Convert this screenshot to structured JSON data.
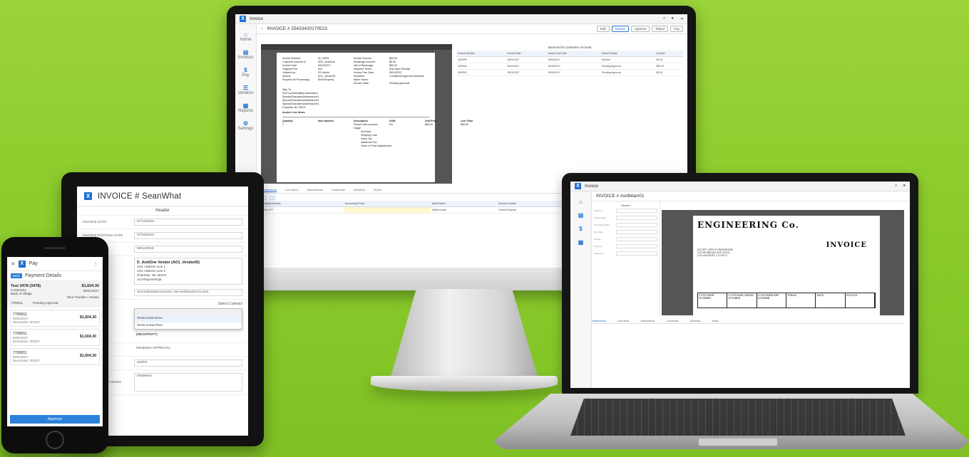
{
  "desktop": {
    "app_name": "Invoice",
    "title": "INVOICE # 25433420170523",
    "toolbar_buttons": [
      "Edit",
      "Submit",
      "Approve",
      "Reject",
      "Pay"
    ],
    "sidebar": [
      "Home",
      "Invoices",
      "Pay",
      "Vendors",
      "Reports",
      "Settings"
    ],
    "doc": {
      "fields": [
        [
          "Invoice Number:",
          "ID_00901",
          "Invoice Amount:",
          "$60.00"
        ],
        [
          "Customer Account #:",
          "ABC_AcctNum",
          "Retainage Amount:",
          "$0.00"
        ],
        [
          "Invoice Date:",
          "05/10/2017",
          "Net of Retainage:",
          "$60.00"
        ],
        [
          "Original PO#:",
          "N/A",
          "Payment Terms:",
          "Due Upon Receipt"
        ],
        [
          "Ordered by:",
          "PO Admin",
          "Invoice Due Date:",
          "05/10/2017"
        ],
        [
          "Vendor:",
          "AO1_VendorID",
          "Workflow:",
          "Conditional Approval Workflow"
        ],
        [
          "Property for Processing:",
          "Multi-Property",
          "Batch Name:",
          ""
        ],
        [
          "",
          "",
          "Invoice State:",
          "Pending Approval"
        ]
      ],
      "ship_to": [
        "Ship To:",
        "Not Found/AvidBuy Automation",
        "SpecialCharactersAddressLine1",
        "SpecialCharactersAddressLine2",
        "SpecialCharactersAddressLine3",
        "Charlotte, NC 28270"
      ],
      "line_items_label": "Invoice Line Items:",
      "line_headers": [
        "Quantity",
        "Item Number",
        "Description",
        "UOM",
        "Unit Price",
        "Line Total"
      ],
      "line_row": [
        "1",
        "",
        "Please view scanned image",
        "EA",
        "$60.00",
        "$60.00"
      ],
      "totals": [
        "SubTotal:",
        "Shipping Cost:",
        "Sales Tax:",
        "Additional Tax:",
        "Other or Price Adjustments:"
      ]
    },
    "right_panel": {
      "title": "Invoices for Customer Account",
      "columns": [
        "Invoice Number",
        "Invoice Date",
        "Invoice Due Date",
        "Invoice Status",
        "Amount"
      ],
      "rows": [
        [
          "ID00099",
          "05/04/2017",
          "05/04/2017",
          "Entered",
          "$0.00"
        ],
        [
          "ID00901",
          "05/10/2017",
          "05/10/2017",
          "Pending Approval",
          "$60.00"
        ],
        [
          "ID00902",
          "05/10/2017",
          "05/10/2017",
          "Pending Approval",
          "$0.00"
        ]
      ]
    },
    "tabs": [
      "Distributions",
      "Line Items",
      "Attachments",
      "Comments",
      "Workflow",
      "Notes"
    ],
    "lines_columns": [
      "Property Number",
      "Accounting Period",
      "Batch Name",
      "Account Number",
      "Total Amount",
      "Tax"
    ],
    "lines_row": [
      "AVID-1PT",
      "",
      "Utility Invoice",
      "Central Expense",
      "",
      "$60.00"
    ]
  },
  "tablet": {
    "title": "INVOICE # SeanWhat",
    "section": "Header",
    "fields": [
      {
        "label": "Invoice Date",
        "value": "07/12/2016"
      },
      {
        "label": "Invoice Posting Date",
        "value": "07/18/2016"
      },
      {
        "label": "Due Date",
        "value": "08/11/2016"
      }
    ],
    "vendor": {
      "name": "D_AvidOne Vendor (AO1_VendorID)",
      "lines": [
        "AO1 Address Line 1",
        "AO1 Address Line 2",
        "Charlotte, NC 28270",
        "ACHPaymentOpt"
      ]
    },
    "account_label": "Account #",
    "account_value": "SecondVendorAccount, SecondVendorAccount",
    "select_contract": "Select Contract",
    "contract_options": [
      "TestContractOne",
      "TestContractTwo"
    ],
    "property_value": "(REGPROP7)",
    "status_label": "Status",
    "status_value": "PENDING APPROVAL",
    "po_value": "testPO",
    "memo_label": "Carriage Info Memo",
    "memo_value": "testMemo"
  },
  "phone": {
    "app_name": "Pay",
    "back": "Back",
    "title": "Payment Details",
    "summary": {
      "name": "Test 3478 (3478)",
      "code": "CV6D1101",
      "amount": "$1,604.30",
      "date": "06/01/2017",
      "bank": "Bank of Village",
      "method": "Wire Transfer / Vendor",
      "ref": "7700011",
      "status": "Pending Approval"
    },
    "cards": [
      {
        "id": "7700011",
        "date": "06/01/2017",
        "amount": "$1,604.30",
        "desc": "Description: 001107"
      },
      {
        "id": "7700011",
        "date": "06/01/2017",
        "amount": "$1,604.30",
        "desc": "Description: 001107"
      },
      {
        "id": "7700011",
        "date": "06/01/2017",
        "amount": "$1,604.30",
        "desc": "Description: 001107"
      }
    ],
    "approve": "Approve"
  },
  "laptop": {
    "app_name": "Invoice",
    "title": "INVOICE # AvidMain01",
    "form_header": "Header",
    "form_labels": [
      "Invoice #",
      "Invoice Date",
      "Accounting Date",
      "Due Date",
      "Vendor",
      "Property",
      "Account #"
    ],
    "doc_company": "ENGINEERING Co.",
    "doc_heading": "INVOICE",
    "doc_address": [
      "EQUITY OFFICE PROPERTIES",
      "333 WE BROAD AVE #1030",
      "LOS ANGELES, CA 90071"
    ],
    "grid_cells": [
      "CUSTOMER NUMBER",
      "CUSTOMER ORDER NUMBER",
      "CUSTOMER REF NUMBER",
      "TERMS",
      "DATE",
      "INVOICE"
    ],
    "tabs": [
      "Distributions",
      "Line Items",
      "Attachments",
      "Comments",
      "Workflow",
      "Notes"
    ]
  },
  "colors": {
    "background": "#8ccc2c",
    "accent": "#2b7bd6"
  }
}
